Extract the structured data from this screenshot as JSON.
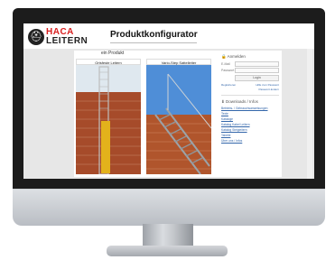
{
  "header": {
    "logo_line1": "HACA",
    "logo_line2": "LEITERN",
    "title": "Produktkonfigurator"
  },
  "breadcrumb": "ein Produkt",
  "products": [
    {
      "label": "Ortsfeste Leitern"
    },
    {
      "label": "Vario-Step Sattelleiter"
    }
  ],
  "login": {
    "title": "Anmelden",
    "user_label": "E-Mail",
    "password_label": "Passwort",
    "button": "Login",
    "register_link": "Registrieren",
    "forgot_link": "Hilfe zum Passwort",
    "extra_link": "Passwort ändern"
  },
  "downloads": {
    "title": "Downloads / Infos",
    "items": [
      "Betriebs- / Gebrauchsanweisungen",
      "Texte",
      "Kataloge",
      "Katalog Kabel Leitern",
      "Katalog Steigleitern",
      "Tabelle",
      "Über uns / Infos"
    ]
  }
}
